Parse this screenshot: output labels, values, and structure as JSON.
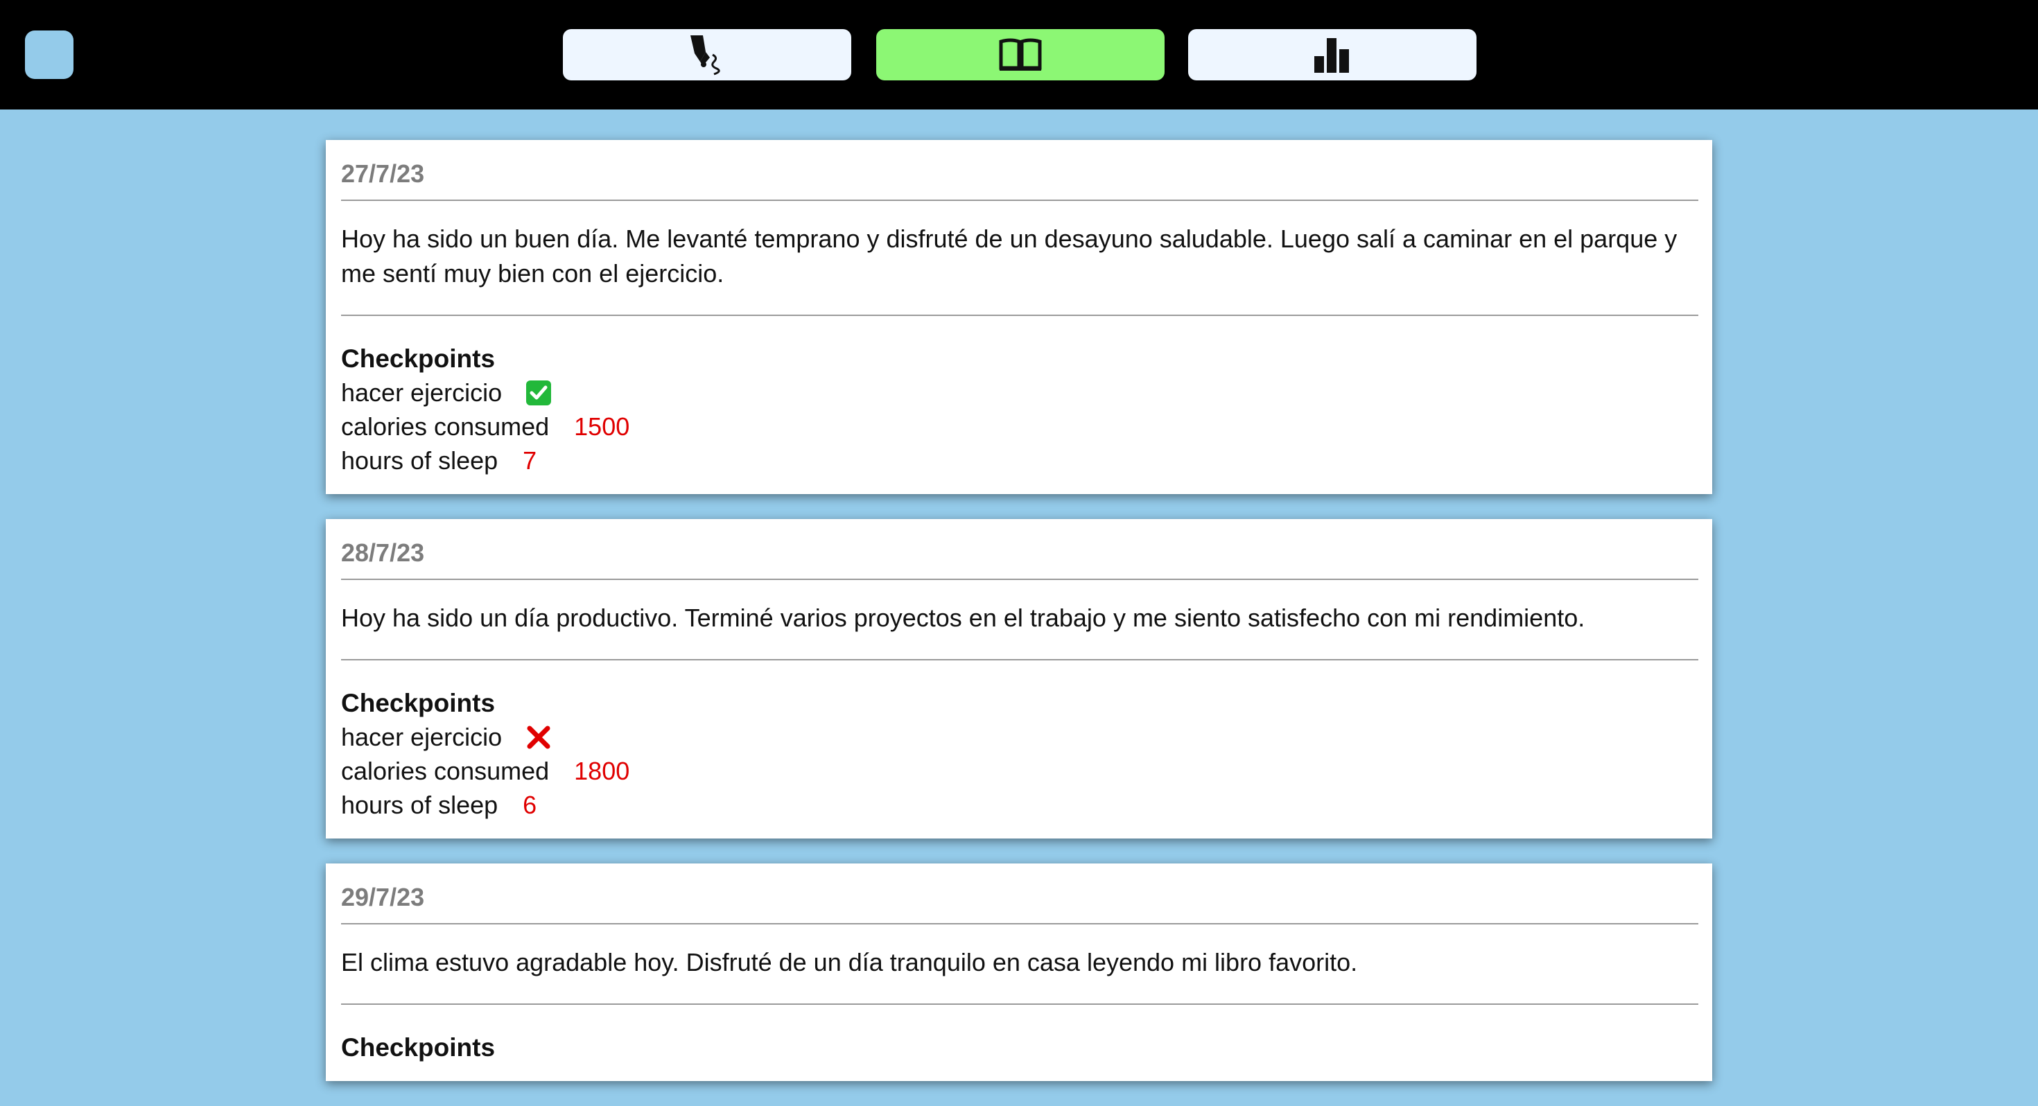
{
  "nav": {
    "buttons": [
      {
        "icon": "pen-nib-icon",
        "color": "#eef6ff"
      },
      {
        "icon": "open-book-icon",
        "color": "#8cf774"
      },
      {
        "icon": "bar-chart-icon",
        "color": "#eef6ff"
      }
    ]
  },
  "entries": [
    {
      "date": "27/7/23",
      "text": "Hoy ha sido un buen día. Me levanté temprano y disfruté de un desayuno saludable. Luego salí a caminar en el parque y me sentí muy bien con el ejercicio.",
      "checkpoints_title": "Checkpoints",
      "checkpoints": [
        {
          "label": "hacer ejercicio",
          "done": true
        },
        {
          "label": "calories consumed",
          "value": "1500"
        },
        {
          "label": "hours of sleep",
          "value": "7"
        }
      ]
    },
    {
      "date": "28/7/23",
      "text": "Hoy ha sido un día productivo. Terminé varios proyectos en el trabajo y me siento satisfecho con mi rendimiento.",
      "checkpoints_title": "Checkpoints",
      "checkpoints": [
        {
          "label": "hacer ejercicio",
          "done": false
        },
        {
          "label": "calories consumed",
          "value": "1800"
        },
        {
          "label": "hours of sleep",
          "value": "6"
        }
      ]
    },
    {
      "date": "29/7/23",
      "text": "El clima estuvo agradable hoy. Disfruté de un día tranquilo en casa leyendo mi libro favorito.",
      "checkpoints_title": "Checkpoints"
    }
  ],
  "colors": {
    "background": "#94cbea",
    "topbar": "#000000",
    "active_tab": "#8cf774",
    "inactive_tab": "#eef6ff",
    "value_red": "#e00000",
    "check_green": "#22b83a"
  }
}
